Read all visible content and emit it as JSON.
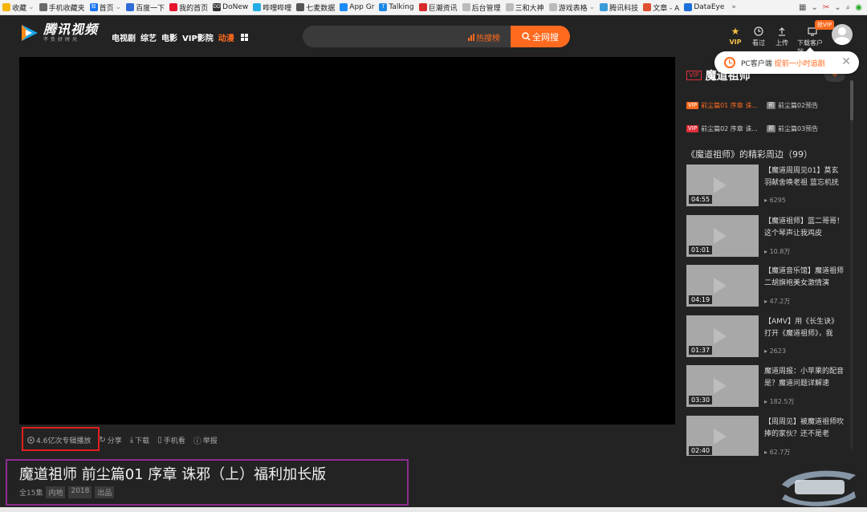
{
  "bookmarks": [
    {
      "label": "收藏",
      "color": "#f5b400",
      "dropdown": true
    },
    {
      "label": "手机收藏夹",
      "color": "#6a6a6a"
    },
    {
      "label": "首页",
      "icon_text": "知",
      "color": "#1772f6",
      "dropdown": true
    },
    {
      "label": "百度一下",
      "color": "#2f6cd9"
    },
    {
      "label": "我的首页",
      "color": "#e6162d"
    },
    {
      "label": "DoNew",
      "icon_text": "DD",
      "color": "#333333"
    },
    {
      "label": "哔哩哔哩",
      "color": "#23ade5"
    },
    {
      "label": "七麦数据",
      "color": "#555555"
    },
    {
      "label": "App Gr",
      "color": "#1d8cf8"
    },
    {
      "label": "Talking",
      "icon_text": "T",
      "color": "#1e88e5"
    },
    {
      "label": "巨潮资讯",
      "color": "#d72a2a"
    },
    {
      "label": "后台管理",
      "color": "#bbbbbb"
    },
    {
      "label": "三和大神",
      "color": "#bbbbbb"
    },
    {
      "label": "游戏表格",
      "color": "#bbbbbb",
      "dropdown": true
    },
    {
      "label": "腾讯科技",
      "color": "#3a9bd9"
    },
    {
      "label": "文章 - A",
      "color": "#e04f2f"
    },
    {
      "label": "DataEye",
      "color": "#1e6fd9"
    }
  ],
  "bookmarks_more": "»",
  "header": {
    "logo_title": "腾讯视频",
    "logo_slogan": "不负好时光",
    "nav": [
      {
        "label": "电视剧",
        "active": false
      },
      {
        "label": "综艺",
        "active": false
      },
      {
        "label": "电影",
        "active": false
      },
      {
        "label": "VIP影院",
        "active": false
      },
      {
        "label": "动漫",
        "active": true
      }
    ],
    "search_placeholder": "",
    "hot_rank": "热搜榜",
    "search_button": "全网搜",
    "tools": {
      "vip": "VIP",
      "history": "看过",
      "upload": "上传",
      "download_client": "下载客户端",
      "badge": "抢VIP"
    }
  },
  "popup": {
    "text": "PC客户端",
    "link": "提前一小时追剧",
    "close": "✕"
  },
  "controls": {
    "play_count": "4.6亿次专辑播放",
    "share": "分享",
    "download": "下载",
    "mobile": "手机看",
    "report": "举报"
  },
  "side": {
    "vip_tag": "VIP",
    "title": "魔道祖师",
    "episodes": [
      {
        "tag": "cur",
        "tag_text": "VIP",
        "label": "前尘篇01 序章 诛...",
        "current": true
      },
      {
        "tag": "trailer",
        "tag_text": "预",
        "label": "前尘篇02预告",
        "current": false
      },
      {
        "tag": "vip",
        "tag_text": "VIP",
        "label": "前尘篇02 序章 诛...",
        "current": false
      },
      {
        "tag": "trailer",
        "tag_text": "预",
        "label": "前尘篇03预告",
        "current": false
      }
    ],
    "related_title": "《魔道祖师》的精彩周边（99）",
    "related": [
      {
        "duration": "04:55",
        "title": "【魔道周周见01】莫玄羽献舍唤老祖 蓝忘机抚",
        "views": "6295"
      },
      {
        "duration": "01:01",
        "title": "【魔道祖师】蓝二哥哥！这个琴声让我鸡皮",
        "views": "10.8万"
      },
      {
        "duration": "04:19",
        "title": "【魔道音乐馆】魔道祖师 二胡旗袍美女激情演",
        "views": "47.2万"
      },
      {
        "duration": "01:37",
        "title": "【AMV】用《长生诀》打开《魔道祖师》，我",
        "views": "2623"
      },
      {
        "duration": "03:30",
        "title": "魔道周报：小苹果的配音是？魔道问题详解速",
        "views": "182.5万"
      },
      {
        "duration": "02:40",
        "title": "【周周见】被魔道祖师吹捧的家伙？还不是老",
        "views": "62.7万"
      }
    ]
  },
  "info": {
    "title": "魔道祖师 前尘篇01 序章 诛邪（上）福利加长版",
    "tags": [
      {
        "label": "全15集",
        "plain": true
      },
      {
        "label": "内地",
        "plain": false
      },
      {
        "label": "2018",
        "plain": false
      },
      {
        "label": "出品",
        "plain": false
      }
    ]
  },
  "colors": {
    "accent": "#ff6a1e",
    "vip_red": "#e0303a",
    "highlight_box": "#e02020",
    "info_box": "#8b2c8f",
    "background": "#232323"
  },
  "icons": {
    "logo": "tencent-video-play-logo",
    "search": "magnifier-icon",
    "fire": "fire-icon",
    "vip": "crown-icon",
    "history": "clock-icon",
    "upload": "upload-arrow-icon",
    "client": "monitor-icon",
    "play": "play-circle-icon",
    "share": "share-icon",
    "download": "download-icon",
    "mobile": "phone-icon",
    "report": "warning-icon"
  }
}
